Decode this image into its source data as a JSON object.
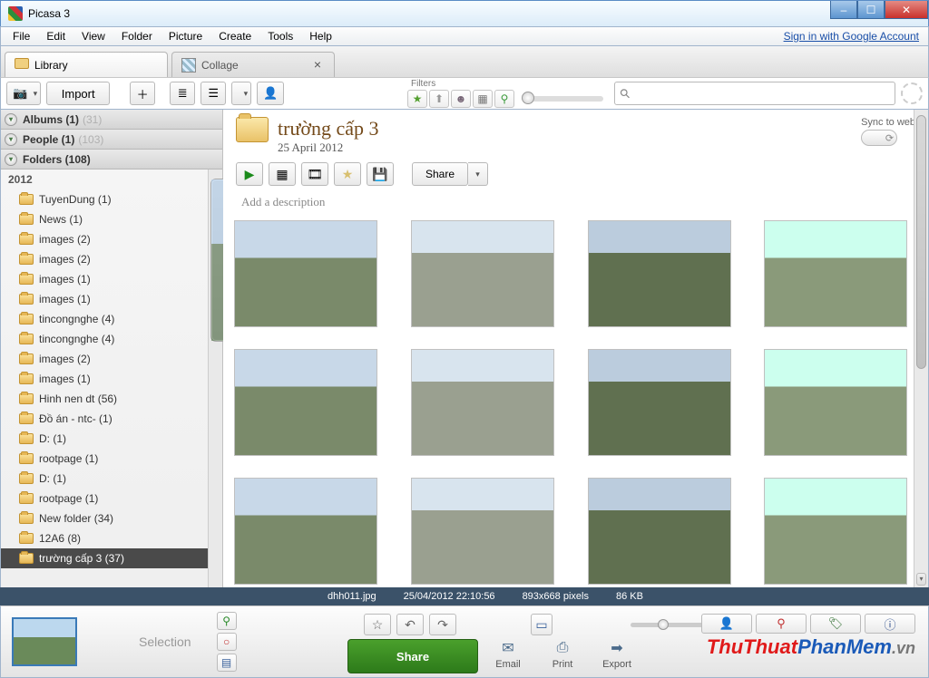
{
  "window": {
    "title": "Picasa 3"
  },
  "menu": {
    "items": [
      "File",
      "Edit",
      "View",
      "Folder",
      "Picture",
      "Create",
      "Tools",
      "Help"
    ],
    "signin": "Sign in with Google Account"
  },
  "tabs": [
    {
      "label": "Library",
      "kind": "lib",
      "active": true,
      "closable": false
    },
    {
      "label": "Collage",
      "kind": "col",
      "active": false,
      "closable": true
    }
  ],
  "toolbar": {
    "import_label": "Import",
    "filters_label": "Filters",
    "search_placeholder": ""
  },
  "sidebar": {
    "sections": [
      {
        "title": "Albums (1)",
        "faded": "(31)"
      },
      {
        "title": "People (1)",
        "faded": "(103)"
      },
      {
        "title": "Folders (108)"
      }
    ],
    "year": "2012",
    "folders": [
      {
        "name": "TuyenDung (1)"
      },
      {
        "name": "News (1)"
      },
      {
        "name": "images (2)"
      },
      {
        "name": "images (2)"
      },
      {
        "name": "images (1)"
      },
      {
        "name": "images (1)"
      },
      {
        "name": "tincongnghe (4)"
      },
      {
        "name": "tincongnghe (4)"
      },
      {
        "name": "images (2)"
      },
      {
        "name": "images (1)"
      },
      {
        "name": "Hinh nen dt (56)"
      },
      {
        "name": "Đồ án - ntc- (1)"
      },
      {
        "name": "D: (1)"
      },
      {
        "name": "rootpage (1)"
      },
      {
        "name": "D: (1)"
      },
      {
        "name": "rootpage (1)"
      },
      {
        "name": "New folder (34)"
      },
      {
        "name": "12A6 (8)"
      },
      {
        "name": "trường cấp 3 (37)",
        "selected": true
      }
    ]
  },
  "content": {
    "folder_title": "trường cấp 3",
    "folder_date": "25 April 2012",
    "sync_label": "Sync to web",
    "share_label": "Share",
    "desc_placeholder": "Add a description",
    "thumb_count": 12
  },
  "status": {
    "filename": "dhh011.jpg",
    "datetime": "25/04/2012 22:10:56",
    "dimensions": "893x668 pixels",
    "filesize": "86 KB"
  },
  "bottom": {
    "selection_label": "Selection",
    "share_label": "Share",
    "actions": [
      {
        "label": "Email",
        "icon": "✉"
      },
      {
        "label": "Print",
        "icon": "⎙"
      },
      {
        "label": "Export",
        "icon": "➡"
      }
    ],
    "watermark": {
      "a": "ThuThuat",
      "b": "PhanMem",
      "c": ".vn"
    }
  }
}
